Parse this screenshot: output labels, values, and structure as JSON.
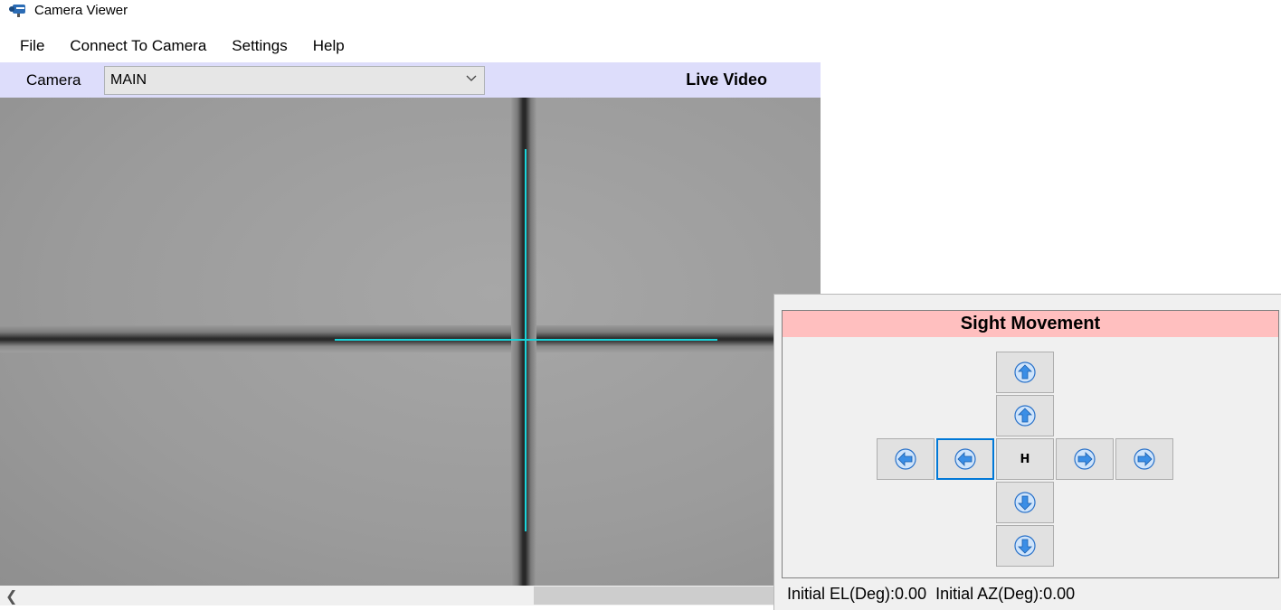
{
  "window": {
    "title": "Camera Viewer"
  },
  "menu": {
    "items": [
      "File",
      "Connect To Camera",
      "Settings",
      "Help"
    ]
  },
  "camera_bar": {
    "label": "Camera",
    "selected": "MAIN",
    "status": "Live Video"
  },
  "colors": {
    "camera_bar_bg": "#ddddfb",
    "crosshair": "#19d3d9",
    "panel_header_bg": "#ffbfbf",
    "focus_border": "#0078d7",
    "arrow_fill": "#3a8ee6"
  },
  "sight_movement": {
    "title": "Sight Movement",
    "home_label": "H",
    "buttons": [
      {
        "name": "up-large",
        "icon": "arrow-up-icon"
      },
      {
        "name": "up-small",
        "icon": "arrow-up-icon"
      },
      {
        "name": "left-large",
        "icon": "arrow-left-icon"
      },
      {
        "name": "left-small",
        "icon": "arrow-left-icon"
      },
      {
        "name": "home",
        "icon": ""
      },
      {
        "name": "right-small",
        "icon": "arrow-right-icon"
      },
      {
        "name": "right-large",
        "icon": "arrow-right-icon"
      },
      {
        "name": "down-small",
        "icon": "arrow-down-icon"
      },
      {
        "name": "down-large",
        "icon": "arrow-down-icon"
      }
    ]
  },
  "status_bar": {
    "initial_el": "Initial EL(Deg):0.00",
    "initial_az": "Initial AZ(Deg):0.00"
  }
}
